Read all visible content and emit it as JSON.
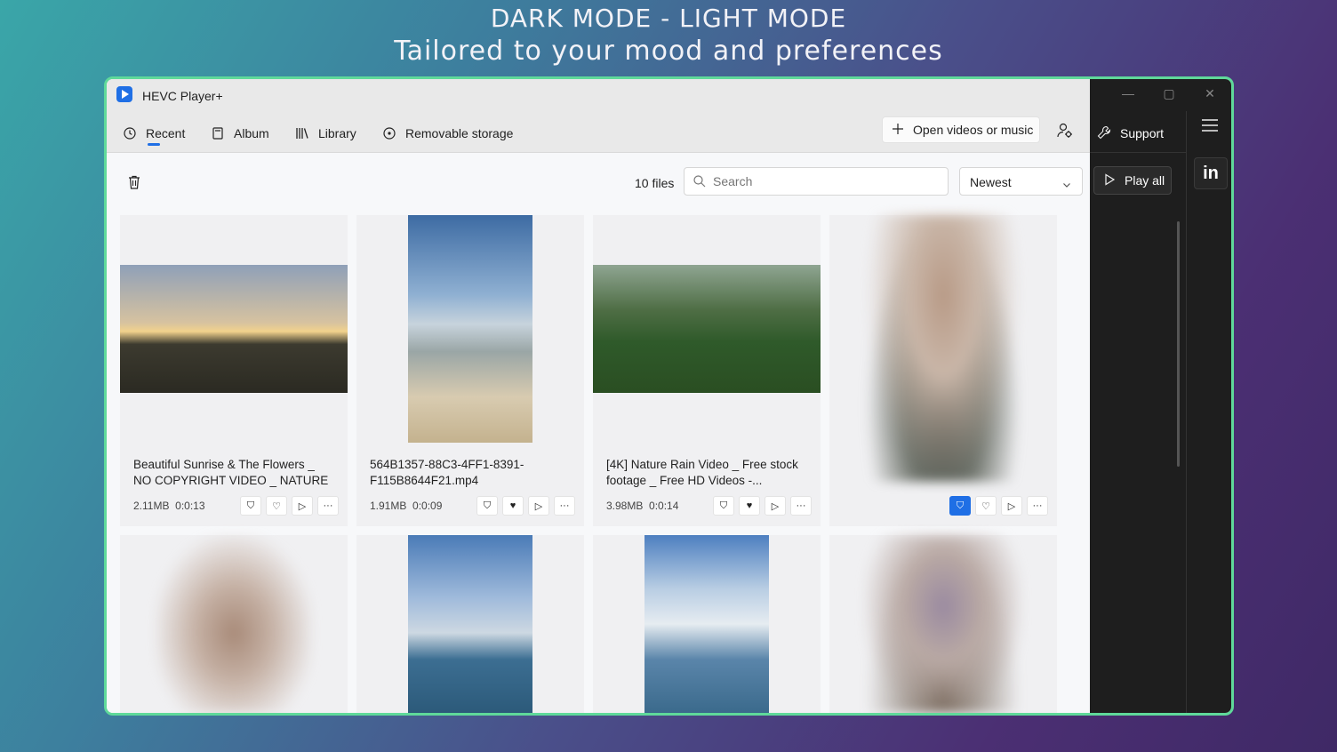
{
  "promo": {
    "line1": "DARK MODE - LIGHT MODE",
    "line2": "Tailored to your mood and preferences"
  },
  "app": {
    "title": "HEVC Player+"
  },
  "nav": {
    "tabs": [
      {
        "label": "Recent",
        "icon": "clock-icon",
        "active": true
      },
      {
        "label": "Album",
        "icon": "album-icon"
      },
      {
        "label": "Library",
        "icon": "library-icon"
      },
      {
        "label": "Removable storage",
        "icon": "disc-icon"
      }
    ],
    "open_label": "Open videos or music"
  },
  "toolbar": {
    "file_count": "10 files",
    "search_placeholder": "Search",
    "sort_value": "Newest"
  },
  "files": [
    {
      "title": "Beautiful Sunrise & The Flowers _ NO COPYRIGHT VIDEO _ NATURE",
      "size": "2.11MB",
      "duration": "0:0:13",
      "favorite": false,
      "protected": false
    },
    {
      "title": "564B1357-88C3-4FF1-8391-F115B8644F21.mp4",
      "size": "1.91MB",
      "duration": "0:0:09",
      "favorite": true,
      "protected": false
    },
    {
      "title": "[4K] Nature Rain Video  _ Free stock footage _  Free HD Videos -...",
      "size": "3.98MB",
      "duration": "0:0:14",
      "favorite": true,
      "protected": false
    },
    {
      "title": "",
      "size": "",
      "duration": "",
      "favorite": false,
      "protected": true
    }
  ],
  "side": {
    "support_label": "Support",
    "play_all_label": "Play all",
    "linkedin_label": "in"
  },
  "colors": {
    "accent": "#1f6fe5",
    "frame": "#5fd99a",
    "dark_panel": "#1e1e1e"
  }
}
